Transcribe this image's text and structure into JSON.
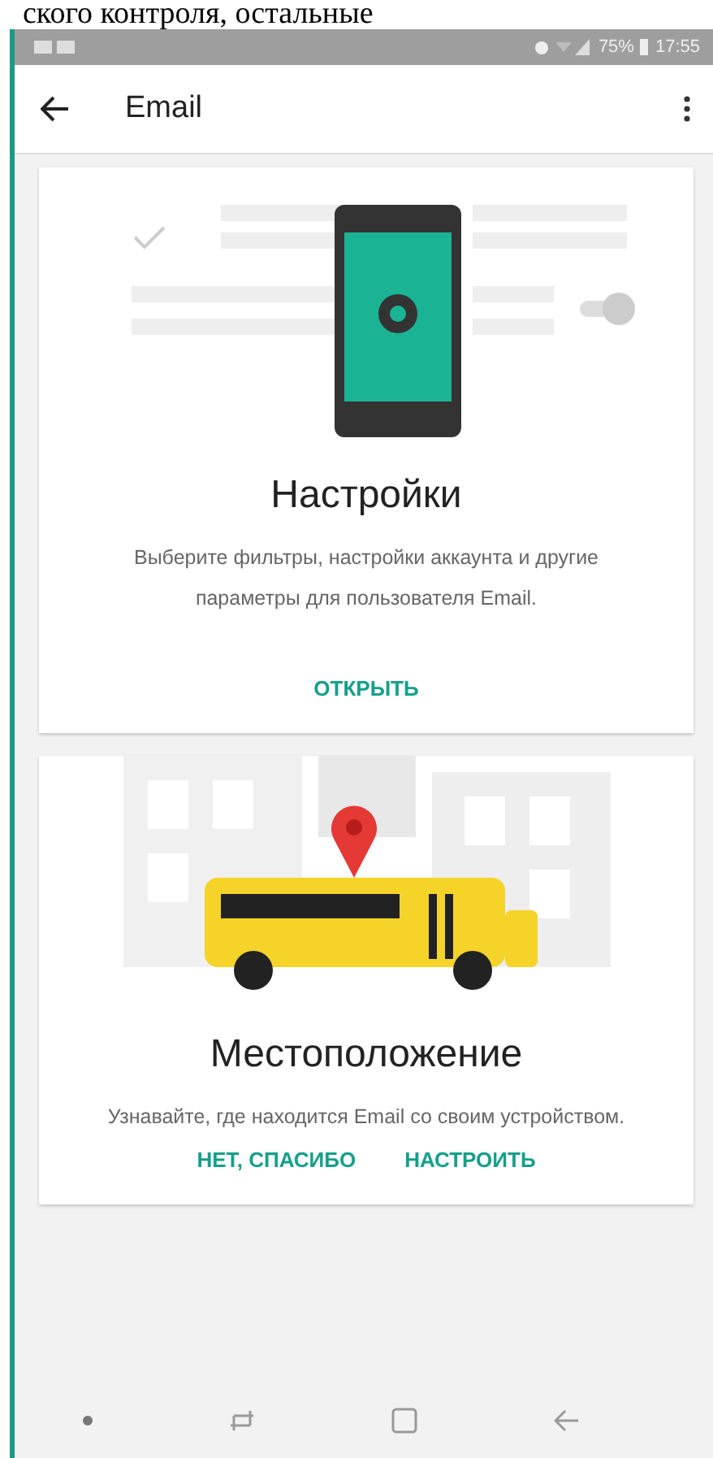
{
  "page_text": "ского контроля, остальные",
  "status_bar": {
    "battery": "75%",
    "time": "17:55"
  },
  "app_bar": {
    "title": "Email"
  },
  "cards": [
    {
      "kind": "settings",
      "title": "Настройки",
      "description": "Выберите фильтры, настройки аккаунта и другие параметры для пользователя Email.",
      "actions": [
        "ОТКРЫТЬ"
      ]
    },
    {
      "kind": "location",
      "title": "Местоположение",
      "description": "Узнавайте, где находится Email со своим устройством.",
      "actions": [
        "НЕТ, СПАСИБО",
        "НАСТРОИТЬ"
      ]
    }
  ]
}
